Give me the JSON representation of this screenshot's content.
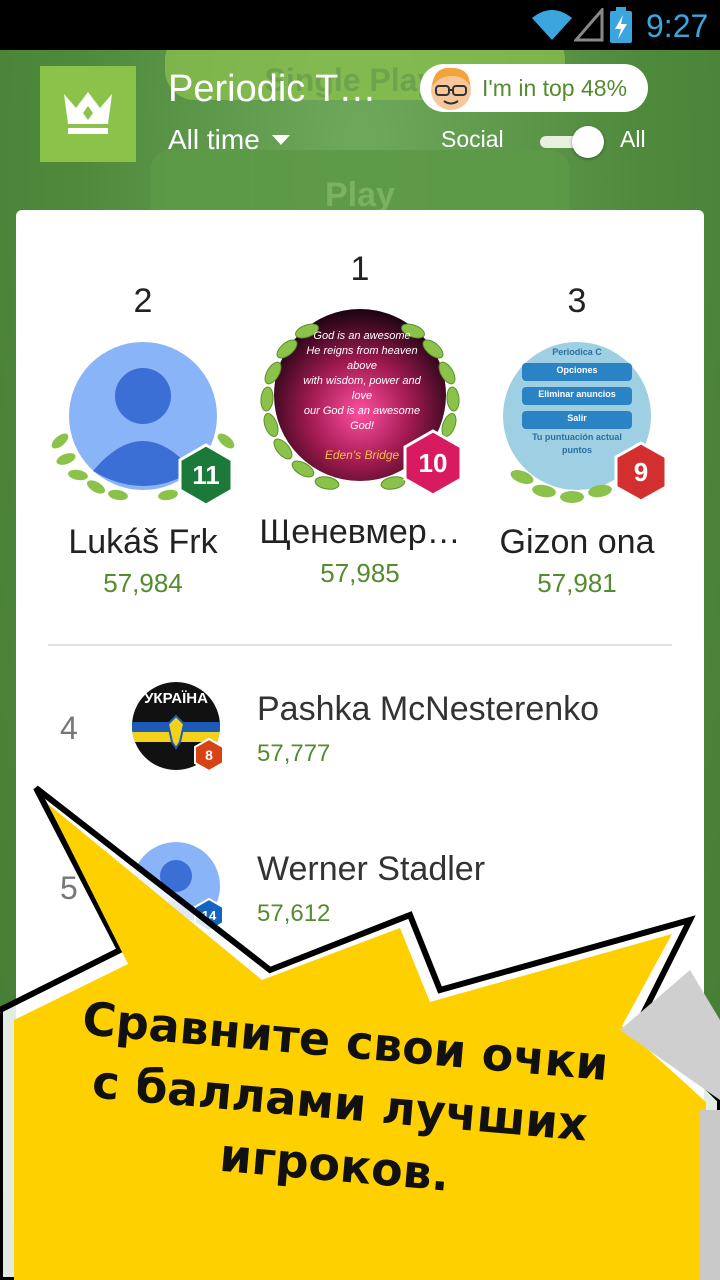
{
  "status_bar": {
    "time": "9:27",
    "wifi_icon": "wifi-icon",
    "signal_icon": "signal-icon",
    "battery_icon": "battery-charging-icon"
  },
  "background": {
    "button1": "Single Player",
    "button2": "Play"
  },
  "header": {
    "title": "Periodic T…",
    "timeframe": "All time",
    "rank_pill": "I'm in top 48%",
    "toggle_left": "Social",
    "toggle_right": "All",
    "toggle_state": "All",
    "colors": {
      "accent": "#8bc34a",
      "score": "#558b2f"
    }
  },
  "podium": [
    {
      "rank": "2",
      "name": "Lukáš Frk",
      "score": "57,984",
      "level": "11",
      "level_color": "#1b7a3a"
    },
    {
      "rank": "1",
      "name": "Щеневмер…",
      "score": "57,985",
      "level": "10",
      "level_color": "#d81b60",
      "avatar_text": [
        "God is an awesome",
        "He reigns from heaven above",
        "with wisdom, power and love",
        "our God is an awesome God!",
        "Eden's Bridge"
      ]
    },
    {
      "rank": "3",
      "name": "Gizon ona",
      "score": "57,981",
      "level": "9",
      "level_color": "#d32f2f",
      "avatar_text": [
        "Periodica C",
        "Opciones",
        "Eliminar anuncios",
        "Salir",
        "Tu puntuación actual",
        "puntos"
      ]
    }
  ],
  "list": [
    {
      "rank": "4",
      "name": "Pashka McNesterenko",
      "score": "57,777",
      "level": "8",
      "level_color": "#d84315",
      "avatar_text": "УКРАЇНА"
    },
    {
      "rank": "5",
      "name": "Werner Stadler",
      "score": "57,612",
      "level": "14",
      "level_color": "#1565c0"
    }
  ],
  "promo": {
    "text": "Сравните свои очки с баллами лучших игроков."
  }
}
